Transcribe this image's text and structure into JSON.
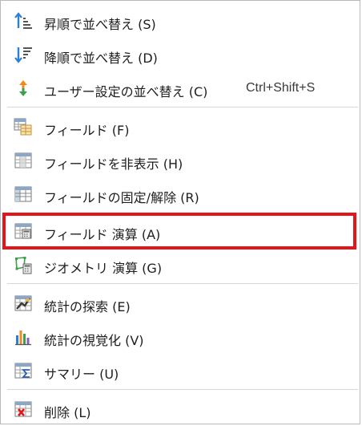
{
  "menu": {
    "items": [
      {
        "label": "昇順で並べ替え (S)",
        "icon": "sort-ascending-icon"
      },
      {
        "label": "降順で並べ替え (D)",
        "icon": "sort-descending-icon"
      },
      {
        "label": "ユーザー設定の並べ替え (C)",
        "icon": "custom-sort-icon",
        "shortcut": "Ctrl+Shift+S"
      },
      {
        "label": "フィールド (F)",
        "icon": "fields-icon"
      },
      {
        "label": "フィールドを非表示 (H)",
        "icon": "hide-field-icon"
      },
      {
        "label": "フィールドの固定/解除 (R)",
        "icon": "freeze-field-icon"
      },
      {
        "label": "フィールド 演算 (A)",
        "icon": "calculate-field-icon",
        "highlighted": true
      },
      {
        "label": "ジオメトリ 演算 (G)",
        "icon": "calculate-geometry-icon"
      },
      {
        "label": "統計の探索 (E)",
        "icon": "explore-statistics-icon"
      },
      {
        "label": "統計の視覚化 (V)",
        "icon": "visualize-statistics-icon"
      },
      {
        "label": "サマリー (U)",
        "icon": "summarize-icon"
      },
      {
        "label": "削除 (L)",
        "icon": "delete-field-icon"
      }
    ]
  },
  "colors": {
    "highlight_border": "#e3151a",
    "arrow_blue": "#2b7fd6",
    "arrow_orange": "#f08a1c",
    "arrow_green": "#3aa14a"
  }
}
